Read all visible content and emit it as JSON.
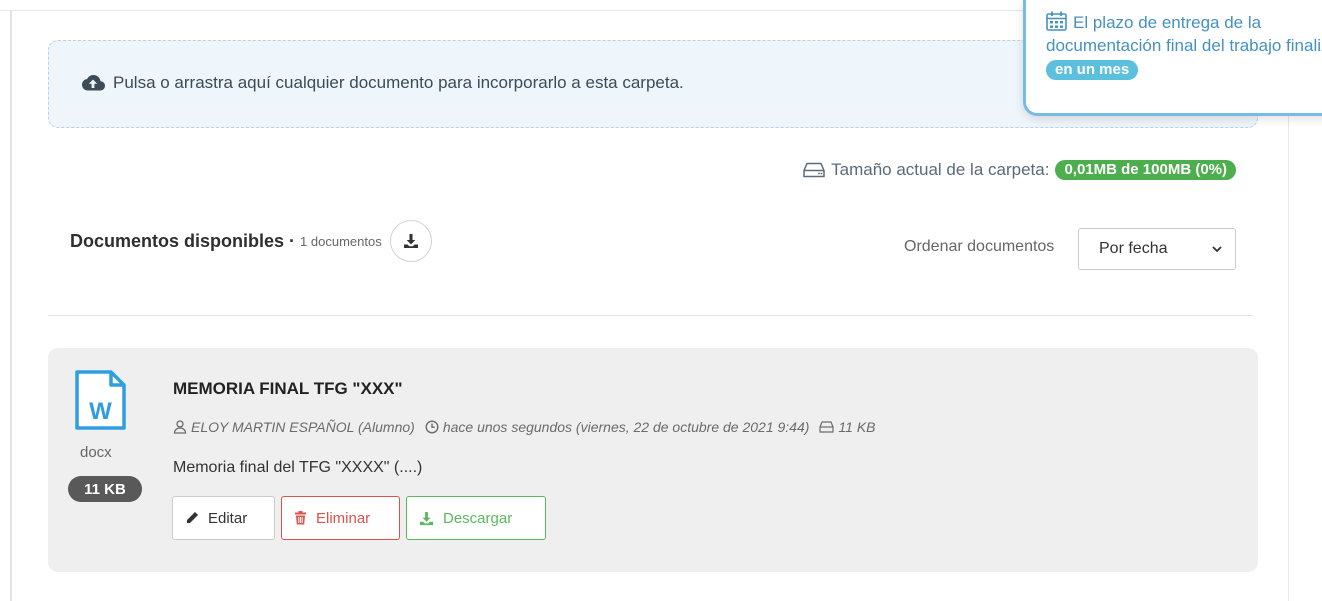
{
  "top_fragment": "",
  "dropzone": {
    "icon": "cloud-upload-icon",
    "text": "Pulsa o arrastra aquí cualquier documento para incorporarlo a esta carpeta."
  },
  "deadline": {
    "icon": "calendar-icon",
    "text": "El plazo de entrega de la documentación final del trabajo finaliza",
    "badge": "en un mes",
    "border_color": "#76bce3",
    "text_color": "#4591c2"
  },
  "folder_size": {
    "icon": "hard-drive-icon",
    "label": "Tamaño actual de la carpeta:",
    "badge": "0,01MB de 100MB (0%)",
    "badge_color": "#4cae4c"
  },
  "documents": {
    "title": "Documentos disponibles",
    "separator": "·",
    "count": "1 documentos",
    "download_all_icon": "download-icon"
  },
  "sort": {
    "label": "Ordenar documentos",
    "selected": "Por fecha"
  },
  "doc": {
    "file_icon": "word-file-icon",
    "extension": "docx",
    "size_badge": "11 KB",
    "title": "MEMORIA FINAL TFG \"XXX\"",
    "author": "ELOY MARTIN ESPAÑOL (Alumno)",
    "time": "hace unos segundos (viernes, 22 de octubre de 2021 9:44)",
    "size": "11 KB",
    "description": "Memoria final del TFG \"XXXX\" (....)",
    "buttons": {
      "edit": "Editar",
      "delete": "Eliminar",
      "download": "Descargar"
    }
  },
  "colors": {
    "danger": "#d9534f",
    "success": "#5cb85c",
    "info": "#5bc0de"
  }
}
